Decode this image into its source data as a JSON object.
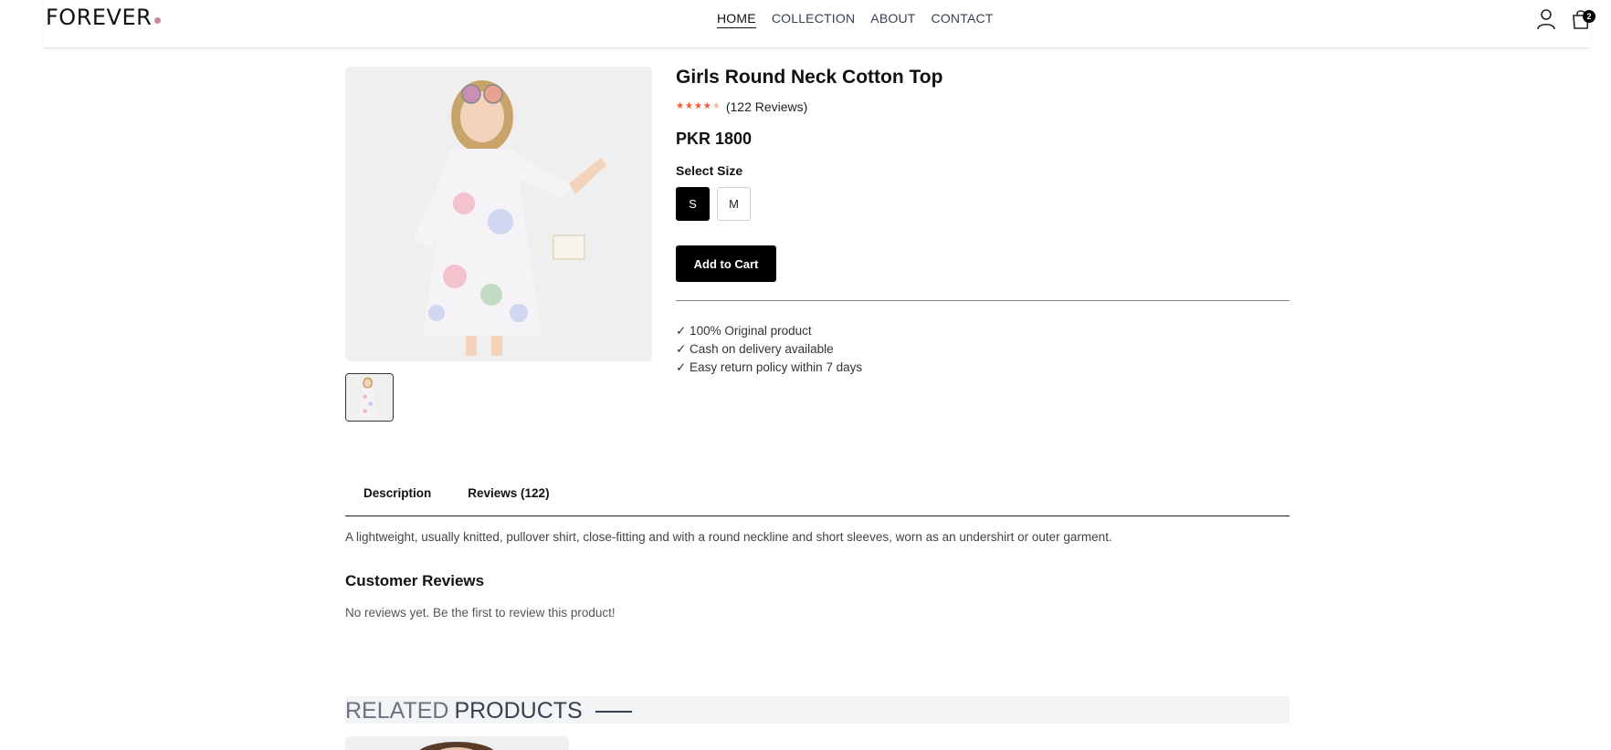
{
  "brand": {
    "logo_text": "FOREVER",
    "dot_color": "#c586a5"
  },
  "nav": {
    "items": [
      {
        "label": "HOME",
        "active": true
      },
      {
        "label": "COLLECTION",
        "active": false
      },
      {
        "label": "ABOUT",
        "active": false
      },
      {
        "label": "CONTACT",
        "active": false
      }
    ]
  },
  "header_icons": {
    "profile": "user-icon",
    "cart": "bag-icon",
    "cart_count": "2"
  },
  "product": {
    "title": "Girls Round Neck Cotton Top",
    "rating": 4,
    "rating_max": 5,
    "reviews_text": "(122 Reviews)",
    "price": "PKR 1800",
    "size_label": "Select Size",
    "sizes": [
      {
        "label": "S",
        "selected": true
      },
      {
        "label": "M",
        "selected": false
      }
    ],
    "add_to_cart": "Add to Cart",
    "features": [
      "✓ 100% Original product",
      "✓ Cash on delivery available",
      "✓ Easy return policy within 7 days"
    ]
  },
  "tabs": {
    "description": "Description",
    "reviews": "Reviews (122)"
  },
  "description_text": "A lightweight, usually knitted, pullover shirt, close-fitting and with a round neckline and short sleeves, worn as an undershirt or outer garment.",
  "customer_reviews": {
    "heading": "Customer Reviews",
    "empty": "No reviews yet. Be the first to review this product!"
  },
  "related": {
    "title_a": "RELATED",
    "title_b": "PRODUCTS"
  },
  "colors": {
    "star": "#ff532e",
    "accent": "#000000"
  }
}
